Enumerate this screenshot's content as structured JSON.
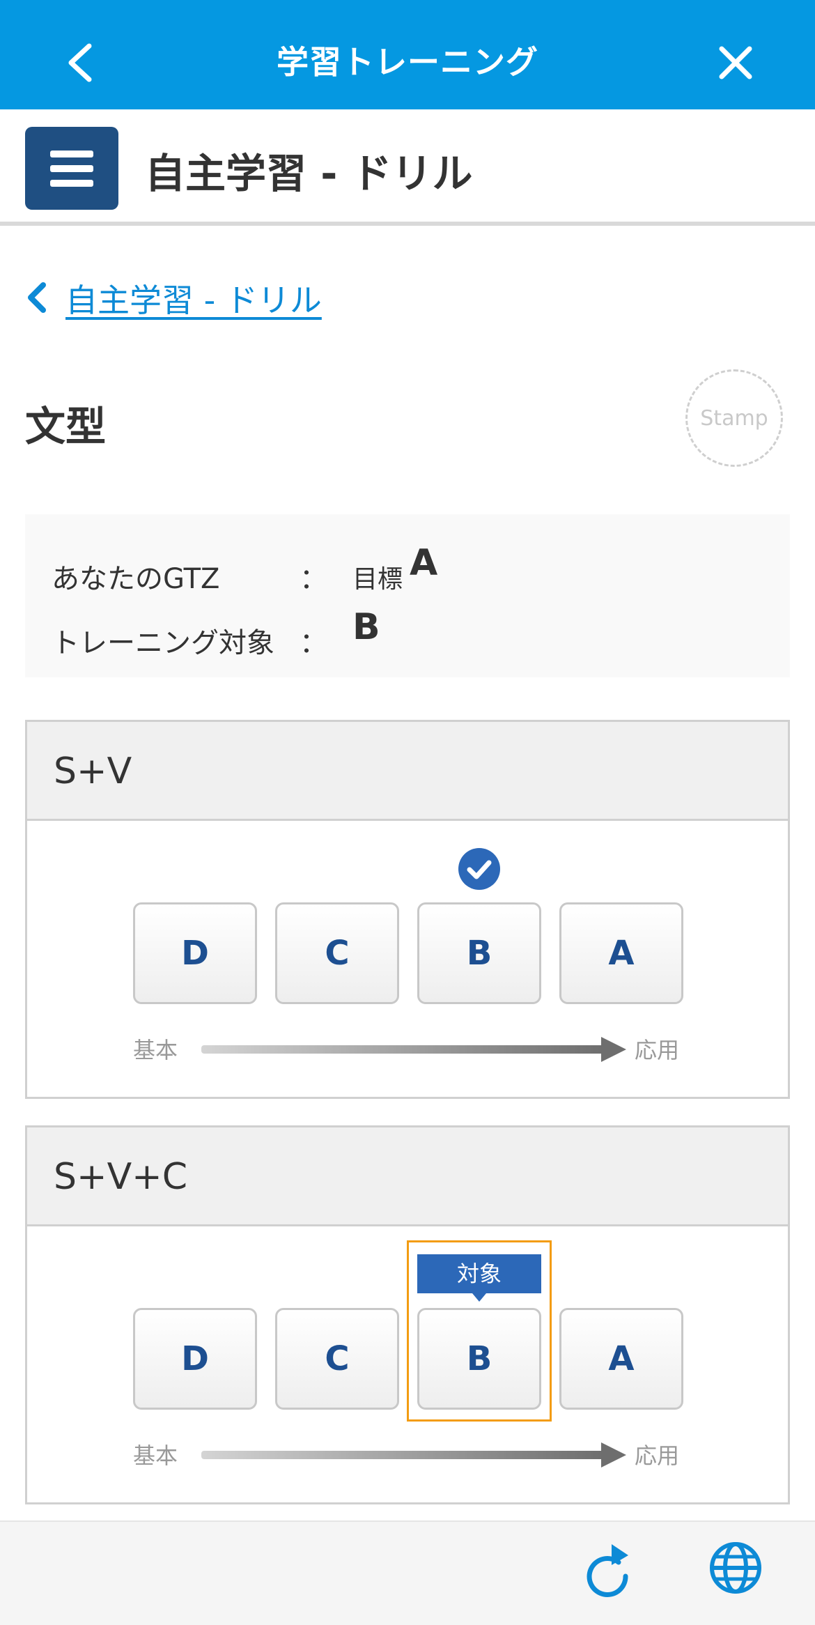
{
  "topbar": {
    "title": "学習トレーニング"
  },
  "subheader": {
    "title": "自主学習 - ドリル"
  },
  "breadcrumb": {
    "label": "自主学習 - ドリル"
  },
  "page": {
    "title": "文型",
    "stamp": "Stamp"
  },
  "info": {
    "gtz_label": "あなたのGTZ",
    "separator": "：",
    "goal_prefix": "目標",
    "goal_grade": "A",
    "target_label": "トレーニング対象",
    "target_grade": "B"
  },
  "sections": [
    {
      "title": "S+V",
      "levels": [
        "D",
        "C",
        "B",
        "A"
      ],
      "axis_start": "基本",
      "axis_end": "応用",
      "completed_level": "B"
    },
    {
      "title": "S+V+C",
      "levels": [
        "D",
        "C",
        "B",
        "A"
      ],
      "axis_start": "基本",
      "axis_end": "応用",
      "target_level": "B",
      "target_badge": "対象"
    }
  ],
  "icons": {
    "back": "chevron-left-icon",
    "close": "close-icon",
    "menu": "hamburger-menu-icon",
    "crumb": "chevron-left-icon",
    "check": "check-circle-icon",
    "refresh": "refresh-icon",
    "globe": "globe-icon"
  },
  "colors": {
    "header": "#0598e1",
    "menu_button": "#1f4f82",
    "link": "#0d8ad6",
    "level_text": "#1d4f91",
    "target_frame": "#f39c12",
    "target_badge": "#2c68b8"
  }
}
